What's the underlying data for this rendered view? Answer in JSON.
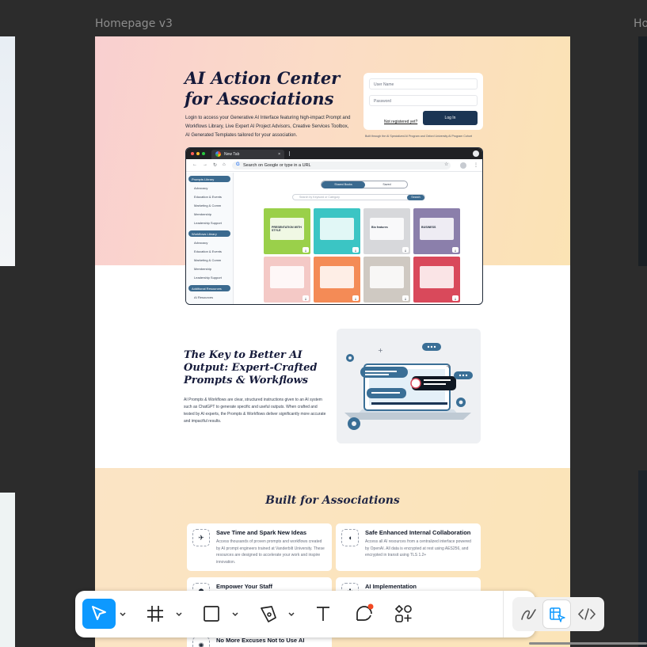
{
  "canvas": {
    "frame_label": "Homepage v3",
    "right_frame_label": "Ho"
  },
  "hero": {
    "title": "AI Action Center for Associations",
    "description": "Login to access your Generative AI Interface featuring high-impact Prompt and Workflows Library, Live Expert AI Project Advisors, Creative Services Toolbox, AI Generated Templates tailored for your association.",
    "login": {
      "username_placeholder": "User Name",
      "password_placeholder": "Password",
      "button": "Log In",
      "forgot": "Not registered yet?"
    },
    "built_through": "Built through the AI Specialized AI Program and Oxford University AI Program Cohort"
  },
  "browser": {
    "tab_title": "New Tab",
    "tab_close": "×",
    "address": "Search on Google or type in a URL",
    "groups": [
      {
        "label": "Prompts Library",
        "items": [
          "Advocacy",
          "Education & Events",
          "Marketing & Comm",
          "Membership",
          "Leadership Support"
        ]
      },
      {
        "label": "Workflows Library",
        "items": [
          "Advocacy",
          "Education & Events",
          "Marketing & Comm",
          "Membership",
          "Leadership Support"
        ]
      },
      {
        "label": "Additional Resources",
        "items": [
          "AI Resources"
        ]
      }
    ],
    "toggle_on": "Shared Books",
    "toggle_off": "Saved",
    "search_placeholder": "Search by Keyword or Category",
    "search_button": "Search",
    "cards": [
      {
        "label": "PRESENTATION WITH STYLE",
        "color": "#9ad04a"
      },
      {
        "label": "",
        "color": "#3bc5c4"
      },
      {
        "label": "Bio features",
        "color": "#d7d8db"
      },
      {
        "label": "BUSINESS",
        "color": "#8b7fab"
      },
      {
        "label": "",
        "color": "#f4c9c6"
      },
      {
        "label": "",
        "color": "#f48b56"
      },
      {
        "label": "",
        "color": "#cfc9c2"
      },
      {
        "label": "",
        "color": "#d9495b"
      }
    ],
    "download_glyph": "⤓"
  },
  "key_section": {
    "title": "The Key to Better AI Output: Expert-Crafted Prompts & Workflows",
    "description": "AI Prompts & Workflows are clear, structured instructions given to an AI system such as ChatGPT to generate specific and useful outputs. When crafted and tested by AI experts, the Prompts & Workflows deliver significantly more accurate and impactful results."
  },
  "built_section": {
    "title": "Built for Associations",
    "cards": [
      {
        "title": "Save Time and Spark New Ideas",
        "icon": "rocket-icon",
        "glyph": "✈",
        "desc": "Access thousands of proven prompts and workflows created by AI prompt engineers trained at Vanderbilt University. These resources are designed to accelerate your work and inspire innovation."
      },
      {
        "title": "Safe Enhanced Internal Collaboration",
        "icon": "shield-icon",
        "glyph": "◖",
        "desc": "Access all AI resources from a centralized interface powered by OpenAI. All data is encrypted at rest using AES256, and encrypted in transit using TLS 1.2+"
      },
      {
        "title": "Empower Your Staff",
        "icon": "team-icon",
        "glyph": "⚉",
        "desc": ""
      },
      {
        "title": "AI Implementation",
        "icon": "network-icon",
        "glyph": "✣",
        "desc": ""
      },
      {
        "title": "No More Excuses Not to Use AI",
        "icon": "spark-icon",
        "glyph": "✺",
        "desc": ""
      }
    ]
  },
  "toolbar": {
    "tools": [
      "move-tool",
      "frame-tool",
      "shape-tool",
      "pen-tool",
      "text-tool",
      "comment-tool",
      "actions-tool"
    ],
    "active": "move-tool",
    "modes": [
      "draw-mode",
      "design-mode",
      "dev-mode"
    ],
    "selected_mode": "design-mode",
    "accent": "#0d99ff"
  }
}
